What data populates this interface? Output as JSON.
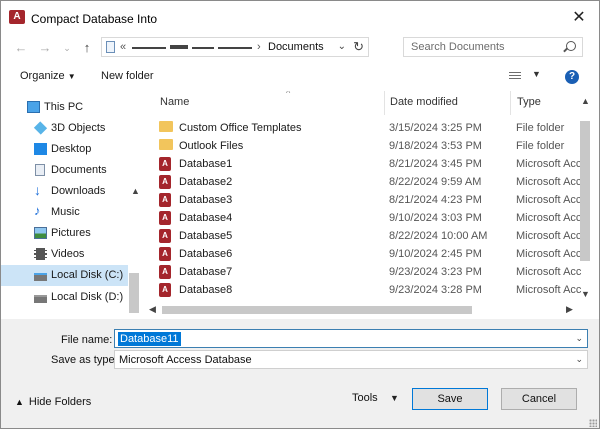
{
  "window": {
    "title": "Compact Database Into",
    "close_glyph": "✕",
    "app_icon_letter": "A"
  },
  "address": {
    "chevron": "«",
    "current_location": "Documents",
    "separator": "›"
  },
  "search": {
    "placeholder": "Search Documents"
  },
  "toolbar": {
    "organize": "Organize",
    "new_folder": "New folder"
  },
  "sidebar": {
    "items": [
      {
        "label": "This PC",
        "icon": "pc-icon"
      },
      {
        "label": "3D Objects",
        "icon": "cube-icon"
      },
      {
        "label": "Desktop",
        "icon": "desktop-icon"
      },
      {
        "label": "Documents",
        "icon": "document-icon"
      },
      {
        "label": "Downloads",
        "icon": "download-icon"
      },
      {
        "label": "Music",
        "icon": "music-icon"
      },
      {
        "label": "Pictures",
        "icon": "picture-icon"
      },
      {
        "label": "Videos",
        "icon": "video-icon"
      },
      {
        "label": "Local Disk (C:)",
        "icon": "disk-icon",
        "selected": true
      },
      {
        "label": "Local Disk (D:)",
        "icon": "disk-icon"
      }
    ]
  },
  "columns": {
    "name": "Name",
    "date": "Date modified",
    "type": "Type"
  },
  "files": [
    {
      "name": "Custom Office Templates",
      "date": "3/15/2024 3:25 PM",
      "type": "File folder",
      "kind": "folder"
    },
    {
      "name": "Outlook Files",
      "date": "9/18/2024 3:53 PM",
      "type": "File folder",
      "kind": "folder"
    },
    {
      "name": "Database1",
      "date": "8/21/2024 3:45 PM",
      "type": "Microsoft Acc",
      "kind": "access"
    },
    {
      "name": "Database2",
      "date": "8/22/2024 9:59 AM",
      "type": "Microsoft Acc",
      "kind": "access"
    },
    {
      "name": "Database3",
      "date": "8/21/2024 4:23 PM",
      "type": "Microsoft Acc",
      "kind": "access"
    },
    {
      "name": "Database4",
      "date": "9/10/2024 3:03 PM",
      "type": "Microsoft Acc",
      "kind": "access"
    },
    {
      "name": "Database5",
      "date": "8/22/2024 10:00 AM",
      "type": "Microsoft Acc",
      "kind": "access"
    },
    {
      "name": "Database6",
      "date": "9/10/2024 2:45 PM",
      "type": "Microsoft Acc",
      "kind": "access"
    },
    {
      "name": "Database7",
      "date": "9/23/2024 3:23 PM",
      "type": "Microsoft Acc",
      "kind": "access"
    },
    {
      "name": "Database8",
      "date": "9/23/2024 3:28 PM",
      "type": "Microsoft Acc",
      "kind": "access"
    }
  ],
  "form": {
    "file_name_label": "File name:",
    "file_name_value": "Database11",
    "save_type_label": "Save as type:",
    "save_type_value": "Microsoft Access Database"
  },
  "footer": {
    "hide_folders": "Hide Folders",
    "tools": "Tools",
    "save": "Save",
    "cancel": "Cancel"
  },
  "colors": {
    "selection": "#0078d7",
    "nav_selected": "#cce4f7",
    "access_red": "#a4262c",
    "folder_yellow": "#f2c55c",
    "help_blue": "#1a5fb4"
  }
}
